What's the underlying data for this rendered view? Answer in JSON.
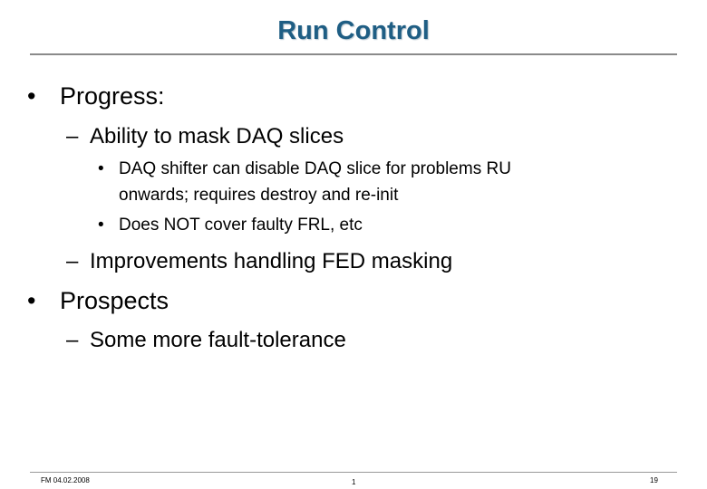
{
  "slide": {
    "title": "Run Control",
    "title_color": "#1f5e84",
    "content": {
      "items": [
        {
          "level": 1,
          "marker": "•",
          "text": "Progress:"
        },
        {
          "level": 2,
          "marker": "–",
          "text": "Ability to mask DAQ slices"
        },
        {
          "level": 3,
          "marker": "•",
          "text": "DAQ shifter can disable DAQ slice for problems RU",
          "continuation": "onwards; requires destroy and re-init"
        },
        {
          "level": 3,
          "marker": "•",
          "text": "Does NOT cover faulty FRL, etc"
        },
        {
          "level": 2,
          "marker": "–",
          "text": "Improvements handling FED masking"
        },
        {
          "level": 1,
          "marker": "•",
          "text": "Prospects"
        },
        {
          "level": 2,
          "marker": "–",
          "text": "Some more fault-tolerance"
        }
      ]
    },
    "footer": {
      "left": "FM 04.02.2008",
      "center": "1",
      "right": "19"
    }
  }
}
